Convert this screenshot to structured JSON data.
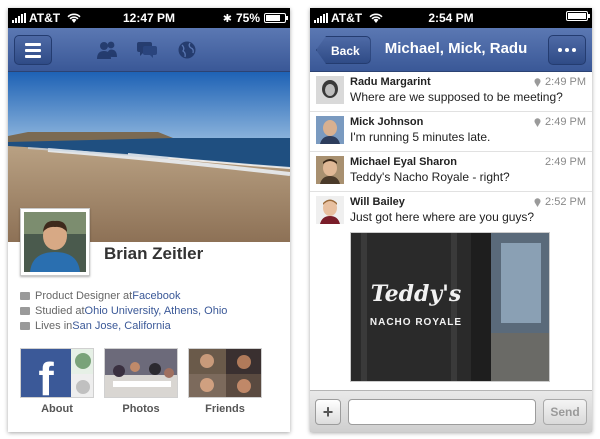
{
  "left_phone": {
    "status_bar": {
      "carrier": "AT&T",
      "time": "12:47 PM",
      "battery": "75%",
      "battery_level": 0.75
    },
    "nav": {
      "menu_icon": "hamburger-icon",
      "icons": [
        "friends-icon",
        "messages-icon",
        "globe-icon"
      ]
    },
    "profile": {
      "name": "Brian Zeitler",
      "info": [
        {
          "icon": "briefcase-icon",
          "prefix": "Product Designer at ",
          "link": "Facebook"
        },
        {
          "icon": "graduation-icon",
          "prefix": "Studied at ",
          "link": "Ohio University, Athens, Ohio"
        },
        {
          "icon": "home-icon",
          "prefix": "Lives in ",
          "link": "San Jose, California"
        }
      ]
    },
    "tiles": [
      {
        "label": "About"
      },
      {
        "label": "Photos"
      },
      {
        "label": "Friends"
      }
    ]
  },
  "right_phone": {
    "status_bar": {
      "carrier": "AT&T",
      "time": "2:54 PM"
    },
    "nav": {
      "back_label": "Back",
      "title": "Michael, Mick, Radu",
      "more_icon": "more-icon"
    },
    "messages": [
      {
        "sender": "Radu Margarint",
        "text": "Where are we supposed to be meeting?",
        "time": "2:49 PM",
        "location": true
      },
      {
        "sender": "Mick Johnson",
        "text": "I'm running 5 minutes late.",
        "time": "2:49 PM",
        "location": true
      },
      {
        "sender": "Michael Eyal Sharon",
        "text": "Teddy's Nacho Royale - right?",
        "time": "2:49 PM",
        "location": false
      },
      {
        "sender": "Will Bailey",
        "text": "Just got here where are you guys?",
        "time": "2:52 PM",
        "location": true
      }
    ],
    "attachment": {
      "sign_line1": "Teddy's",
      "sign_line2": "NACHO ROYALE"
    },
    "compose": {
      "add_label": "+",
      "placeholder": "",
      "send_label": "Send"
    }
  },
  "colors": {
    "facebook_blue": "#3b5998",
    "nav_top": "#5b78b3",
    "nav_bottom": "#3a5897"
  }
}
